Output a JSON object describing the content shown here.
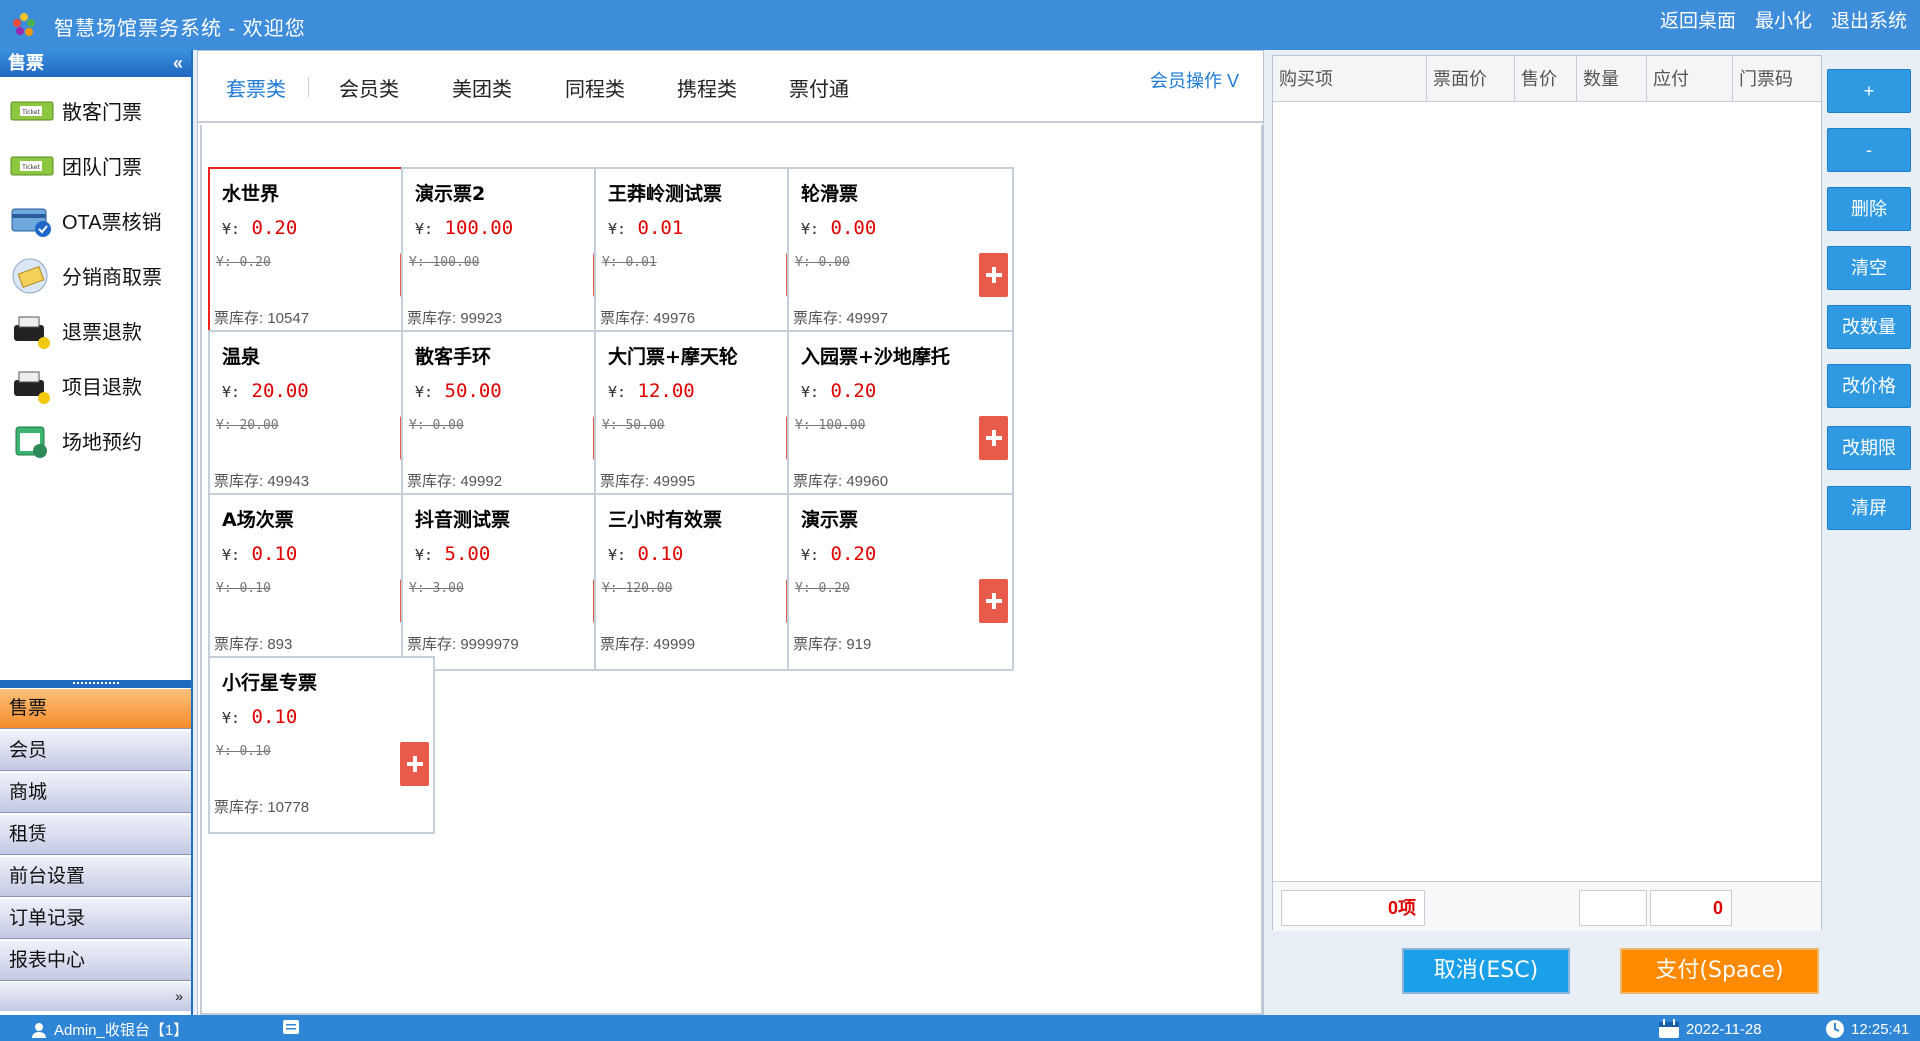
{
  "app": {
    "title": "智慧场馆票务系统 - 欢迎您",
    "controls": [
      "返回桌面",
      "最小化",
      "退出系统"
    ]
  },
  "sidebar": {
    "header": "售票",
    "collapse_glyph": "«",
    "items": [
      {
        "label": "散客门票",
        "icon": "ticket-icon"
      },
      {
        "label": "团队门票",
        "icon": "ticket-icon"
      },
      {
        "label": "OTA票核销",
        "icon": "card-check-icon"
      },
      {
        "label": "分销商取票",
        "icon": "distributor-icon"
      },
      {
        "label": "退票退款",
        "icon": "printer-refund-icon"
      },
      {
        "label": "项目退款",
        "icon": "printer-refund-icon"
      },
      {
        "label": "场地预约",
        "icon": "calendar-booking-icon"
      }
    ],
    "nav": [
      "售票",
      "会员",
      "商城",
      "租赁",
      "前台设置",
      "订单记录",
      "报表中心"
    ],
    "more_glyph": "»"
  },
  "tabs": [
    "套票类",
    "会员类",
    "美团类",
    "同程类",
    "携程类",
    "票付通"
  ],
  "member_op": "会员操作 V",
  "currency_prefix": "¥:",
  "stock_prefix": "票库存: ",
  "products": [
    {
      "name": "水世界",
      "price": "0.20",
      "orig": "¥: 0.20",
      "stock": "10547",
      "selected": true
    },
    {
      "name": "演示票2",
      "price": "100.00",
      "orig": "¥: 100.00",
      "stock": "99923"
    },
    {
      "name": "王莽岭测试票",
      "price": "0.01",
      "orig": "¥: 0.01",
      "stock": "49976"
    },
    {
      "name": "轮滑票",
      "price": "0.00",
      "orig": "¥: 0.00",
      "stock": "49997"
    },
    {
      "name": "温泉",
      "price": "20.00",
      "orig": "¥: 20.00",
      "stock": "49943"
    },
    {
      "name": "散客手环",
      "price": "50.00",
      "orig": "¥: 0.00",
      "stock": "49992"
    },
    {
      "name": "大门票+摩天轮",
      "price": "12.00",
      "orig": "¥: 50.00",
      "stock": "49995"
    },
    {
      "name": "入园票+沙地摩托",
      "price": "0.20",
      "orig": "¥: 100.00",
      "stock": "49960"
    },
    {
      "name": "A场次票",
      "price": "0.10",
      "orig": "¥: 0.10",
      "stock": "893"
    },
    {
      "name": "抖音测试票",
      "price": "5.00",
      "orig": "¥: 3.00",
      "stock": "9999979"
    },
    {
      "name": "三小时有效票",
      "price": "0.10",
      "orig": "¥: 120.00",
      "stock": "49999"
    },
    {
      "name": "演示票",
      "price": "0.20",
      "orig": "¥: 0.20",
      "stock": "919"
    },
    {
      "name": "小行星专票",
      "price": "0.10",
      "orig": "¥: 0.10",
      "stock": "10778"
    }
  ],
  "cart": {
    "columns": [
      "购买项",
      "票面价",
      "售价",
      "数量",
      "应付",
      "门票码"
    ],
    "count": "0项",
    "qty_total": "",
    "total": "0"
  },
  "actions": [
    "+",
    "-",
    "删除",
    "清空",
    "改数量",
    "改价格",
    "改期限",
    "清屏"
  ],
  "payment": {
    "cancel": "取消(ESC)",
    "pay": "支付(Space)"
  },
  "status": {
    "user": "Admin_收银台【1】",
    "date": "2022-11-28",
    "time": "12:25:41"
  },
  "colors": {
    "titlebar": "#3d8ddb",
    "accent_blue": "#2f9ae2",
    "price_red": "#e00000",
    "active_orange": "#f58b2c",
    "pay_orange": "#ff8a00",
    "cancel_blue": "#1aa0e8"
  }
}
